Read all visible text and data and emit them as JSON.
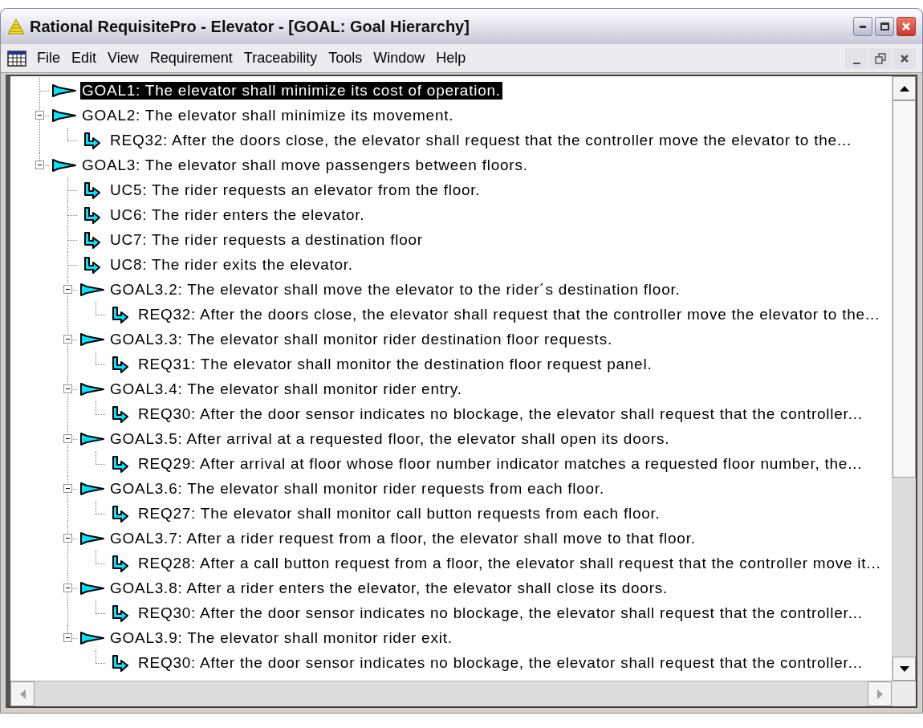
{
  "window": {
    "title": "Rational RequisitePro - Elevator - [GOAL: Goal Hierarchy]"
  },
  "menu": [
    "File",
    "Edit",
    "View",
    "Requirement",
    "Traceability",
    "Tools",
    "Window",
    "Help"
  ],
  "tree": [
    {
      "kind": "goal",
      "text": "GOAL1: The elevator shall minimize its cost of operation.",
      "selected": true
    },
    {
      "kind": "goal",
      "text": "GOAL2: The elevator shall minimize its movement.",
      "selected": false,
      "expanded": true,
      "children": [
        {
          "kind": "req",
          "text": "REQ32: After the doors close, the elevator shall request that the controller move the elevator to the...",
          "selected": false
        }
      ]
    },
    {
      "kind": "goal",
      "text": "GOAL3: The elevator shall move passengers between floors.",
      "selected": false,
      "expanded": true,
      "children": [
        {
          "kind": "req",
          "text": "UC5: The rider requests an elevator from the floor.",
          "selected": false
        },
        {
          "kind": "req",
          "text": "UC6: The rider enters the elevator.",
          "selected": false
        },
        {
          "kind": "req",
          "text": "UC7: The rider requests a destination floor",
          "selected": false
        },
        {
          "kind": "req",
          "text": "UC8: The rider exits the elevator.",
          "selected": false
        },
        {
          "kind": "goal",
          "text": "GOAL3.2: The elevator shall move the elevator to the rider´s destination floor.",
          "selected": false,
          "expanded": true,
          "children": [
            {
              "kind": "req",
              "text": "REQ32: After the doors close, the elevator shall request that the controller move the elevator to the...",
              "selected": false
            }
          ]
        },
        {
          "kind": "goal",
          "text": "GOAL3.3: The elevator shall monitor rider destination floor requests.",
          "selected": false,
          "expanded": true,
          "children": [
            {
              "kind": "req",
              "text": "REQ31: The elevator shall monitor the destination floor request panel.",
              "selected": false
            }
          ]
        },
        {
          "kind": "goal",
          "text": "GOAL3.4: The elevator shall monitor rider entry.",
          "selected": false,
          "expanded": true,
          "children": [
            {
              "kind": "req",
              "text": "REQ30: After the door sensor indicates no blockage, the elevator shall request that the controller...",
              "selected": false
            }
          ]
        },
        {
          "kind": "goal",
          "text": "GOAL3.5: After arrival at a requested floor, the elevator shall open its doors.",
          "selected": false,
          "expanded": true,
          "children": [
            {
              "kind": "req",
              "text": "REQ29: After arrival at floor whose floor number indicator matches a requested floor number, the...",
              "selected": false
            }
          ]
        },
        {
          "kind": "goal",
          "text": "GOAL3.6: The elevator shall monitor rider requests from each floor.",
          "selected": false,
          "expanded": true,
          "children": [
            {
              "kind": "req",
              "text": "REQ27: The elevator shall monitor call button requests from each floor.",
              "selected": false
            }
          ]
        },
        {
          "kind": "goal",
          "text": "GOAL3.7: After a rider request from a floor, the elevator shall move to that floor.",
          "selected": false,
          "expanded": true,
          "children": [
            {
              "kind": "req",
              "text": "REQ28: After a call button request from a floor, the elevator shall request that the controller move it...",
              "selected": false
            }
          ]
        },
        {
          "kind": "goal",
          "text": "GOAL3.8: After a rider enters the elevator, the elevator shall close its doors.",
          "selected": false,
          "expanded": true,
          "children": [
            {
              "kind": "req",
              "text": "REQ30: After the door sensor indicates no blockage, the elevator shall request that the controller...",
              "selected": false
            }
          ]
        },
        {
          "kind": "goal",
          "text": "GOAL3.9: The elevator shall monitor rider exit.",
          "selected": false,
          "expanded": true,
          "children": [
            {
              "kind": "req",
              "text": "REQ30: After the door sensor indicates no blockage, the elevator shall request that the controller...",
              "selected": false
            }
          ]
        }
      ]
    }
  ]
}
